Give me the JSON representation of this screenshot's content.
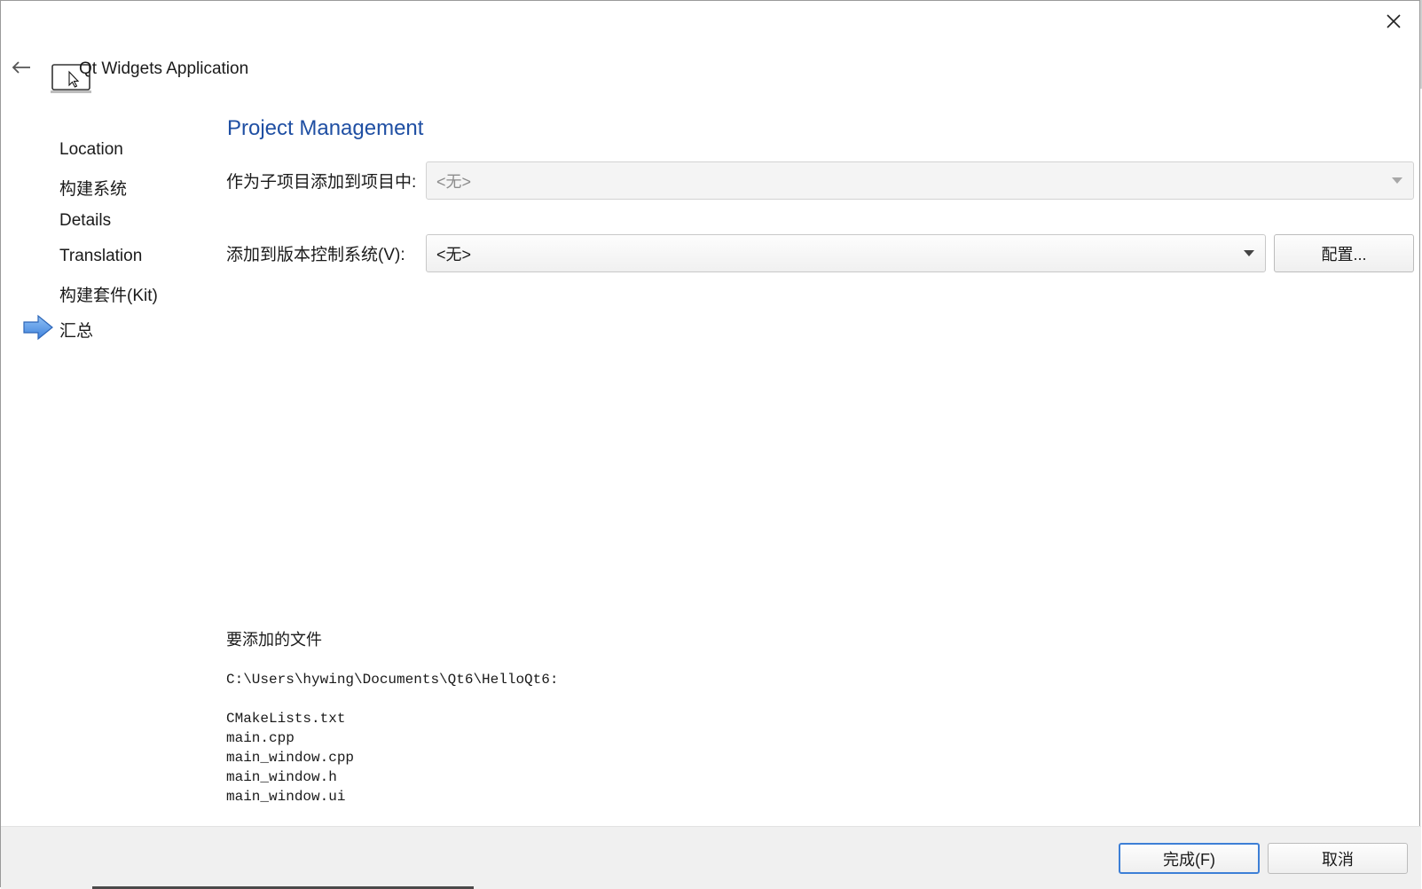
{
  "window": {
    "title": "Qt Widgets Application",
    "icons": {
      "close": "close-icon",
      "back": "back-arrow-icon",
      "app": "monitor-cursor-icon"
    }
  },
  "nav": {
    "items": [
      {
        "label": "Location"
      },
      {
        "label": "构建系统"
      },
      {
        "label": "Details"
      },
      {
        "label": "Translation"
      },
      {
        "label": "构建套件(Kit)"
      },
      {
        "label": "汇总",
        "current": true
      }
    ],
    "current_marker_icon": "blue-arrow-right-icon"
  },
  "main": {
    "title": "Project Management",
    "subproject_label": "作为子项目添加到项目中:",
    "subproject_value": "<无>",
    "vcs_label": "添加到版本控制系统(V):",
    "vcs_value": "<无>",
    "configure_label": "配置...",
    "files_heading": "要添加的文件",
    "files_path": "C:\\Users\\hywing\\Documents\\Qt6\\HelloQt6:",
    "files": [
      "CMakeLists.txt",
      "main.cpp",
      "main_window.cpp",
      "main_window.h",
      "main_window.ui"
    ]
  },
  "footer": {
    "finish_label": "完成(F)",
    "cancel_label": "取消"
  },
  "colors": {
    "section_title": "#1f4fa3",
    "primary_border": "#3d7fd6",
    "footer_bg": "#f0f0f0",
    "nav_arrow": "#4a8fe0"
  }
}
